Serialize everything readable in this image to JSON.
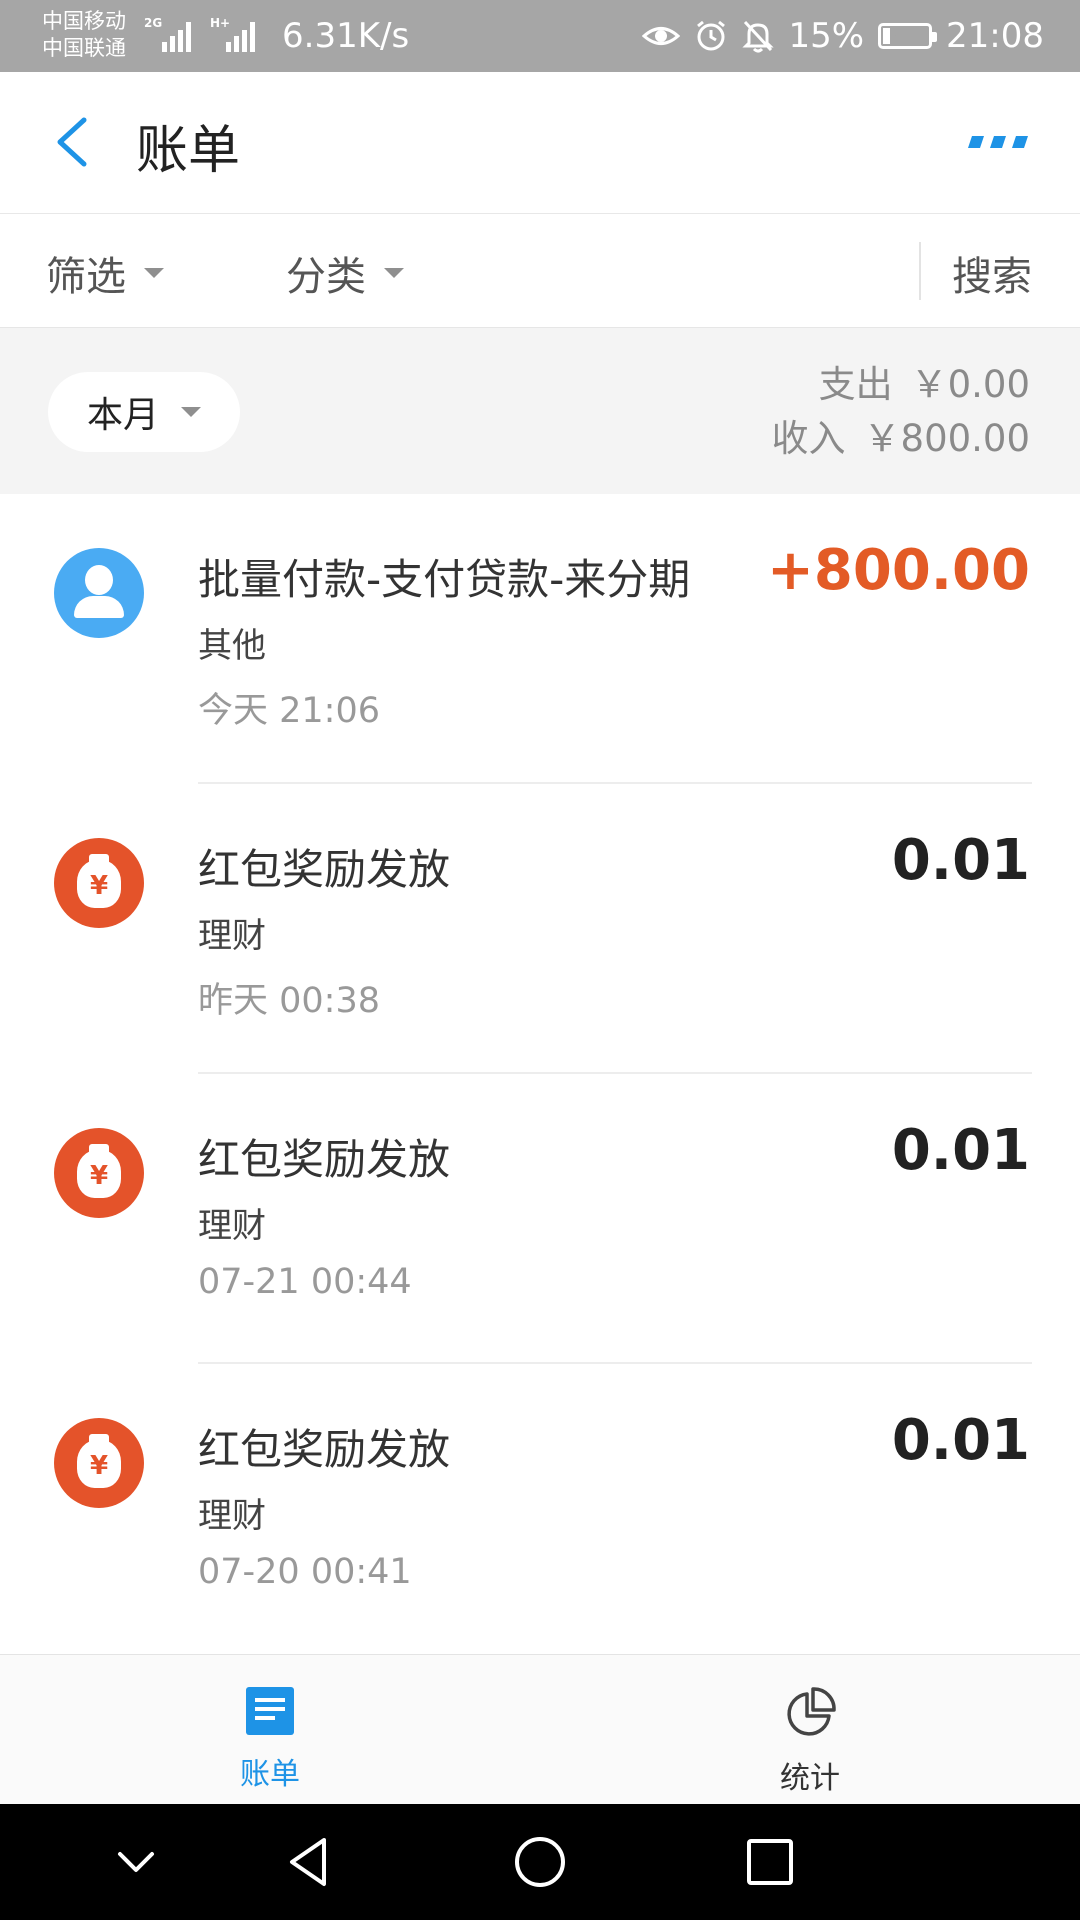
{
  "status_bar": {
    "carrier_1": "中国移动",
    "carrier_2": "中国联通",
    "net_1": "2G",
    "net_2": "H+",
    "speed": "6.31K/s",
    "battery": "15%",
    "battery_level": 0.15,
    "time": "21:08",
    "icons": [
      "eye-icon",
      "alarm-icon",
      "bell-off-icon",
      "battery-charging-icon"
    ]
  },
  "header": {
    "title": "账单"
  },
  "filters": {
    "filter_label": "筛选",
    "category_label": "分类",
    "search_label": "搜索"
  },
  "summary": {
    "month": "本月",
    "expense_label": "支出",
    "expense_value": "￥0.00",
    "income_label": "收入",
    "income_value": "￥800.00"
  },
  "transactions": [
    {
      "title": "批量付款-支付贷款-来分期",
      "category": "其他",
      "time": "今天  21:06",
      "amount": "+800.00",
      "icon": "user-icon"
    },
    {
      "title": "红包奖励发放",
      "category": "理财",
      "time": "昨天  00:38",
      "amount": "0.01",
      "icon": "money-bag-icon"
    },
    {
      "title": "红包奖励发放",
      "category": "理财",
      "time": "07-21  00:44",
      "amount": "0.01",
      "icon": "money-bag-icon"
    },
    {
      "title": "红包奖励发放",
      "category": "理财",
      "time": "07-20  00:41",
      "amount": "0.01",
      "icon": "money-bag-icon"
    }
  ],
  "tabs": {
    "bills": "账单",
    "stats": "统计"
  },
  "colors": {
    "accent": "#1e93e6",
    "income": "#e35b26",
    "status_bar": "#a6a6a6"
  }
}
